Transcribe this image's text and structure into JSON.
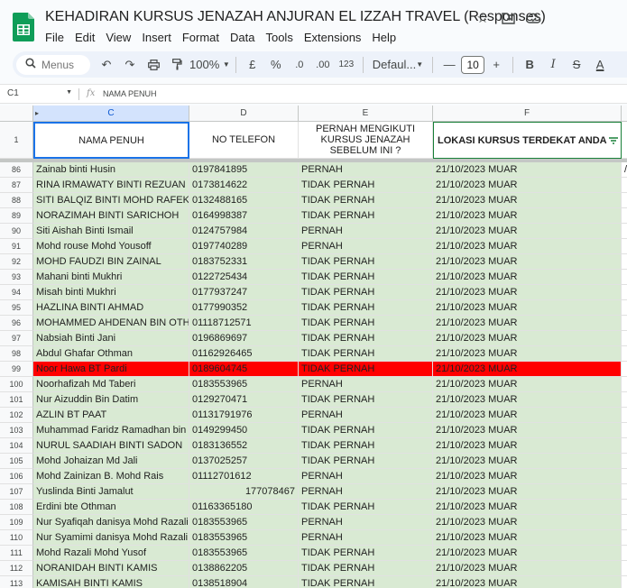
{
  "doc": {
    "title": "KEHADIRAN KURSUS JENAZAH ANJURAN EL IZZAH TRAVEL (Responses)",
    "menu": [
      "File",
      "Edit",
      "View",
      "Insert",
      "Format",
      "Data",
      "Tools",
      "Extensions",
      "Help"
    ]
  },
  "toolbar": {
    "search_placeholder": "Menus",
    "zoom": "100%",
    "currency": "£",
    "percent": "%",
    "dec_decrease": ".0",
    "dec_increase": ".00",
    "number_format": "123",
    "font": "Defaul...",
    "font_size": "10",
    "bold": "B",
    "italic": "I",
    "strike": "S",
    "text_color": "A"
  },
  "formula": {
    "cell_ref": "C1",
    "value": "NAMA PENUH"
  },
  "columns": [
    {
      "letter": "",
      "selected": false
    },
    {
      "letter": "C",
      "selected": true
    },
    {
      "letter": "D",
      "selected": false
    },
    {
      "letter": "E",
      "selected": false
    },
    {
      "letter": "F",
      "selected": false
    }
  ],
  "header_row": {
    "num": "1",
    "cells": [
      "NAMA PENUH",
      "NO TELEFON",
      "PERNAH MENGIKUTI KURSUS JENAZAH SEBELUM INI ?",
      "LOKASI KURSUS TERDEKAT ANDA"
    ]
  },
  "rows": [
    {
      "num": "86",
      "name": "Zainab binti Husin",
      "phone": "0197841895",
      "pernah": "PERNAH",
      "lokasi": "21/10/2023 MUAR",
      "hl": "green"
    },
    {
      "num": "87",
      "name": "RINA IRMAWATY BINTI REZUAN",
      "phone": "0173814622",
      "pernah": "TIDAK PERNAH",
      "lokasi": "21/10/2023 MUAR",
      "hl": "green"
    },
    {
      "num": "88",
      "name": "SITI BALQIZ BINTI MOHD RAFEK",
      "phone": "0132488165",
      "pernah": "TIDAK PERNAH",
      "lokasi": "21/10/2023 MUAR",
      "hl": "green"
    },
    {
      "num": "89",
      "name": "NORAZIMAH BINTI SARICHOH",
      "phone": "0164998387",
      "pernah": "TIDAK PERNAH",
      "lokasi": "21/10/2023 MUAR",
      "hl": "green"
    },
    {
      "num": "90",
      "name": "Siti Aishah Binti Ismail",
      "phone": "0124757984",
      "pernah": "PERNAH",
      "lokasi": "21/10/2023 MUAR",
      "hl": "green"
    },
    {
      "num": "91",
      "name": "Mohd rouse Mohd Yousoff",
      "phone": "0197740289",
      "pernah": "PERNAH",
      "lokasi": "21/10/2023 MUAR",
      "hl": "green"
    },
    {
      "num": "92",
      "name": "MOHD FAUDZI BIN ZAINAL",
      "phone": "0183752331",
      "pernah": "TIDAK PERNAH",
      "lokasi": "21/10/2023 MUAR",
      "hl": "green"
    },
    {
      "num": "93",
      "name": "Mahani binti Mukhri",
      "phone": "0122725434",
      "pernah": "TIDAK PERNAH",
      "lokasi": "21/10/2023 MUAR",
      "hl": "green"
    },
    {
      "num": "94",
      "name": "Misah binti Mukhri",
      "phone": "0177937247",
      "pernah": "TIDAK PERNAH",
      "lokasi": "21/10/2023 MUAR",
      "hl": "green"
    },
    {
      "num": "95",
      "name": "HAZLINA BINTI AHMAD",
      "phone": "0177990352",
      "pernah": "TIDAK PERNAH",
      "lokasi": "21/10/2023 MUAR",
      "hl": "green"
    },
    {
      "num": "96",
      "name": "MOHAMMED AHDENAN BIN OTHMAN",
      "phone": "01118712571",
      "pernah": "TIDAK PERNAH",
      "lokasi": "21/10/2023 MUAR",
      "hl": "green"
    },
    {
      "num": "97",
      "name": "Nabsiah Binti Jani",
      "phone": "0196869697",
      "pernah": "TIDAK PERNAH",
      "lokasi": "21/10/2023 MUAR",
      "hl": "green"
    },
    {
      "num": "98",
      "name": "Abdul Ghafar Othman",
      "phone": "01162926465",
      "pernah": "TIDAK PERNAH",
      "lokasi": "21/10/2023 MUAR",
      "hl": "green"
    },
    {
      "num": "99",
      "name": "Noor Hawa BT Pardi",
      "phone": "0189604745",
      "pernah": "TIDAK PERNAH",
      "lokasi": "21/10/2023 MUAR",
      "hl": "red"
    },
    {
      "num": "100",
      "name": "Noorhafizah Md Taberi",
      "phone": "0183553965",
      "pernah": "PERNAH",
      "lokasi": "21/10/2023 MUAR",
      "hl": "green"
    },
    {
      "num": "101",
      "name": "Nur Aizuddin Bin Datim",
      "phone": "0129270471",
      "pernah": "TIDAK PERNAH",
      "lokasi": "21/10/2023 MUAR",
      "hl": "green"
    },
    {
      "num": "102",
      "name": "AZLIN BT PAAT",
      "phone": "01131791976",
      "pernah": "PERNAH",
      "lokasi": "21/10/2023 MUAR",
      "hl": "green"
    },
    {
      "num": "103",
      "name": "Muhammad Faridz Ramadhan bin rosli",
      "phone": "0149299450",
      "pernah": "TIDAK PERNAH",
      "lokasi": "21/10/2023 MUAR",
      "hl": "green"
    },
    {
      "num": "104",
      "name": "NURUL SAADIAH BINTI SADON",
      "phone": "0183136552",
      "pernah": "TIDAK PERNAH",
      "lokasi": "21/10/2023 MUAR",
      "hl": "green"
    },
    {
      "num": "105",
      "name": "Mohd Johaizan Md Jali",
      "phone": "0137025257",
      "pernah": "TIDAK PERNAH",
      "lokasi": "21/10/2023 MUAR",
      "hl": "green"
    },
    {
      "num": "106",
      "name": "Mohd Zainizan B. Mohd Rais",
      "phone": "01112701612",
      "pernah": "PERNAH",
      "lokasi": "21/10/2023 MUAR",
      "hl": "green"
    },
    {
      "num": "107",
      "name": "Yuslinda Binti Jamalut",
      "phone": "177078467",
      "pernah": "PERNAH",
      "lokasi": "21/10/2023 MUAR",
      "hl": "green",
      "phone_numeric": true
    },
    {
      "num": "108",
      "name": "Erdini bte Othman",
      "phone": "01163365180",
      "pernah": "TIDAK PERNAH",
      "lokasi": "21/10/2023 MUAR",
      "hl": "green"
    },
    {
      "num": "109",
      "name": "Nur Syafiqah danisya Mohd Razali",
      "phone": "0183553965",
      "pernah": "PERNAH",
      "lokasi": "21/10/2023 MUAR",
      "hl": "green"
    },
    {
      "num": "110",
      "name": "Nur Syamimi danisya Mohd Razali",
      "phone": "0183553965",
      "pernah": "PERNAH",
      "lokasi": "21/10/2023 MUAR",
      "hl": "green"
    },
    {
      "num": "111",
      "name": "Mohd Razali Mohd Yusof",
      "phone": "0183553965",
      "pernah": "TIDAK PERNAH",
      "lokasi": "21/10/2023 MUAR",
      "hl": "green"
    },
    {
      "num": "112",
      "name": "NORANIDAH BINTI KAMIS",
      "phone": "0138862205",
      "pernah": "TIDAK PERNAH",
      "lokasi": "21/10/2023 MUAR",
      "hl": "green"
    },
    {
      "num": "113",
      "name": "KAMISAH BINTI KAMIS",
      "phone": "0138518904",
      "pernah": "TIDAK PERNAH",
      "lokasi": "21/10/2023 MUAR",
      "hl": "green"
    }
  ]
}
